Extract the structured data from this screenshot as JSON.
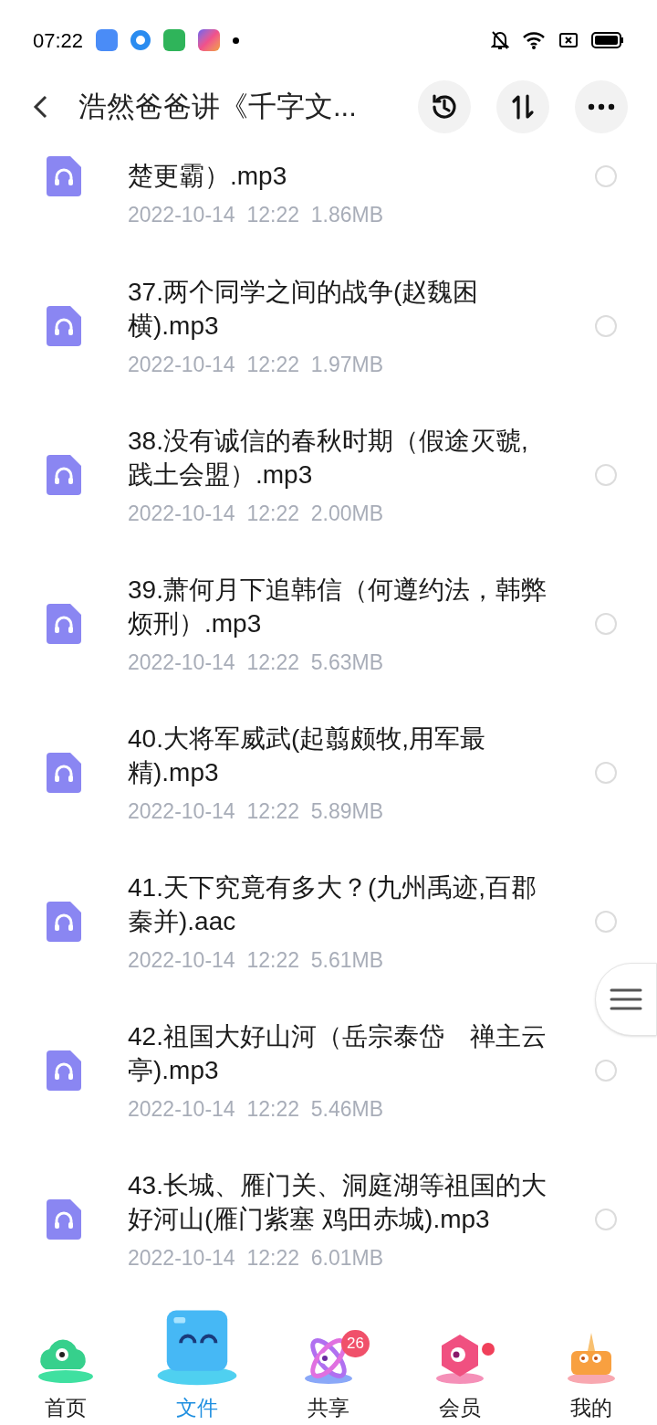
{
  "status_bar": {
    "time": "07:22"
  },
  "header": {
    "title": "浩然爸爸讲《千字文..."
  },
  "files": [
    {
      "name": "楚更霸）.mp3",
      "date": "2022-10-14",
      "time": "12:22",
      "size": "1.86MB",
      "selected": false
    },
    {
      "name": "37.两个同学之间的战争(赵魏困横).mp3",
      "date": "2022-10-14",
      "time": "12:22",
      "size": "1.97MB",
      "selected": false
    },
    {
      "name": "38.没有诚信的春秋时期（假途灭虢,践土会盟）.mp3",
      "date": "2022-10-14",
      "time": "12:22",
      "size": "2.00MB",
      "selected": false
    },
    {
      "name": "39.萧何月下追韩信（何遵约法，韩弊烦刑）.mp3",
      "date": "2022-10-14",
      "time": "12:22",
      "size": "5.63MB",
      "selected": false
    },
    {
      "name": "40.大将军威武(起翦颇牧,用军最精).mp3",
      "date": "2022-10-14",
      "time": "12:22",
      "size": "5.89MB",
      "selected": false
    },
    {
      "name": "41.天下究竟有多大？(九州禹迹,百郡秦并).aac",
      "date": "2022-10-14",
      "time": "12:22",
      "size": "5.61MB",
      "selected": false
    },
    {
      "name": "42.祖国大好山河（岳宗泰岱　禅主云亭).mp3",
      "date": "2022-10-14",
      "time": "12:22",
      "size": "5.46MB",
      "selected": false
    },
    {
      "name": "43.长城、雁门关、洞庭湖等祖国的大好河山(雁门紫塞 鸡田赤城).mp3",
      "date": "2022-10-14",
      "time": "12:22",
      "size": "6.01MB",
      "selected": false
    }
  ],
  "tabs": [
    {
      "label": "首页",
      "selected": false
    },
    {
      "label": "文件",
      "selected": true
    },
    {
      "label": "共享",
      "selected": false,
      "badge": "26"
    },
    {
      "label": "会员",
      "selected": false,
      "dot": true
    },
    {
      "label": "我的",
      "selected": false
    }
  ]
}
